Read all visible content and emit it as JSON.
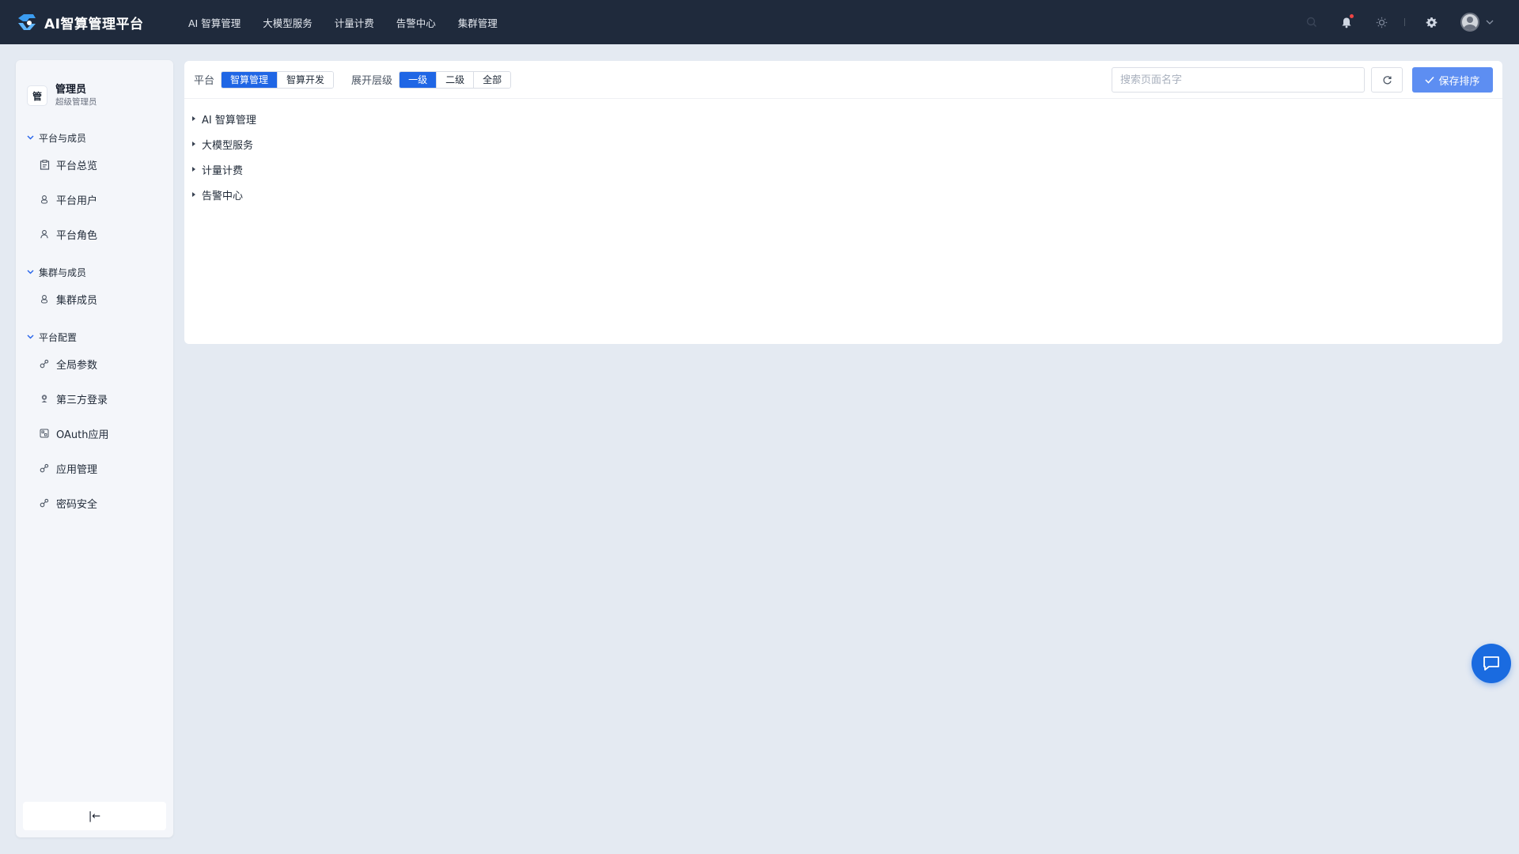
{
  "app": {
    "title": "AI智算管理平台",
    "accent": "#1f66e5",
    "topbar_bg": "#1f2a3c"
  },
  "topnav": [
    {
      "label": "AI 智算管理"
    },
    {
      "label": "大模型服务"
    },
    {
      "label": "计量计费"
    },
    {
      "label": "告警中心"
    },
    {
      "label": "集群管理"
    }
  ],
  "top_icons": [
    "search-icon",
    "bell-icon",
    "sun-icon",
    "gear-icon",
    "avatar",
    "chevron-down-icon"
  ],
  "user": {
    "badge": "管",
    "name": "管理员",
    "role": "超级管理员"
  },
  "sidebar": {
    "groups": [
      {
        "label": "平台与成员",
        "items": [
          {
            "label": "平台总览",
            "icon": "clipboard-icon"
          },
          {
            "label": "平台用户",
            "icon": "users-icon"
          },
          {
            "label": "平台角色",
            "icon": "user-icon"
          }
        ]
      },
      {
        "label": "集群与成员",
        "items": [
          {
            "label": "集群成员",
            "icon": "users-icon"
          }
        ]
      },
      {
        "label": "平台配置",
        "items": [
          {
            "label": "全局参数",
            "icon": "link-icon"
          },
          {
            "label": "第三方登录",
            "icon": "badge-icon"
          },
          {
            "label": "OAuth应用",
            "icon": "app-icon"
          },
          {
            "label": "应用管理",
            "icon": "link-icon"
          },
          {
            "label": "密码安全",
            "icon": "link-icon"
          }
        ]
      }
    ],
    "collapse_label": "|←"
  },
  "toolbar": {
    "platform_label": "平台",
    "platform_options": [
      {
        "label": "智算管理",
        "active": true
      },
      {
        "label": "智算开发",
        "active": false
      }
    ],
    "level_label": "展开层级",
    "level_options": [
      {
        "label": "一级",
        "active": true
      },
      {
        "label": "二级",
        "active": false
      },
      {
        "label": "全部",
        "active": false
      }
    ],
    "search_placeholder": "搜索页面名字",
    "search_value": "",
    "save_label": "保存排序"
  },
  "tree": [
    {
      "label": "AI 智算管理"
    },
    {
      "label": "大模型服务"
    },
    {
      "label": "计量计费"
    },
    {
      "label": "告警中心"
    }
  ]
}
